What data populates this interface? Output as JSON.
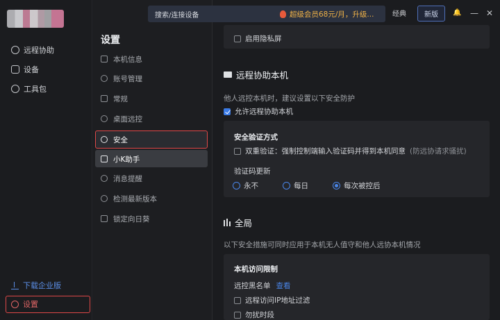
{
  "nav": {
    "items": [
      {
        "label": "远程协助",
        "icon": "remote-assist-icon"
      },
      {
        "label": "设备",
        "icon": "monitor-icon"
      },
      {
        "label": "工具包",
        "icon": "compass-icon"
      }
    ],
    "download_label": "下载企业版",
    "settings_label": "设置"
  },
  "topbar": {
    "search_label": "搜索/连接设备",
    "promo_text": "超级会员68元/月，升级...",
    "classic_label": "经典",
    "new_label": "新版",
    "bell_glyph": "🔔",
    "minimize_glyph": "—",
    "close_glyph": "✕"
  },
  "settings_panel": {
    "title": "设置",
    "items": [
      {
        "label": "本机信息"
      },
      {
        "label": "账号管理"
      },
      {
        "label": "常规"
      },
      {
        "label": "桌面远控"
      },
      {
        "label": "安全"
      },
      {
        "label": "小K助手"
      },
      {
        "label": "消息提醒"
      },
      {
        "label": "检测最新版本"
      },
      {
        "label": "锁定向日葵"
      }
    ],
    "selected": "安全"
  },
  "content": {
    "privacy_screen_label": "启用隐私屏",
    "remote_section": {
      "title": "远程协助本机",
      "desc": "他人远控本机时，建议设置以下安全防护",
      "allow_label": "允许远程协助本机",
      "allow_checked": true,
      "auth_title": "安全验证方式",
      "dual_label": "双重验证：强制控制端输入验证码并得到本机同意",
      "dual_hint": "(防远协请求骚扰)",
      "code_update_title": "验证码更新",
      "radio_options": [
        "永不",
        "每日",
        "每次被控后"
      ],
      "radio_selected": "每次被控后"
    },
    "global_section": {
      "title": "全局",
      "desc": "以下安全措施可同时应用于本机无人值守和他人远协本机情况",
      "access_title": "本机访问限制",
      "blacklist_label": "远控黑名单",
      "blacklist_link": "查看",
      "ip_filter_label": "远程访问IP地址过滤",
      "dnd_label": "勿扰时段"
    }
  },
  "colors": {
    "accent": "#4a86e8",
    "highlight_border": "#e04848",
    "promo": "#f0b247"
  }
}
